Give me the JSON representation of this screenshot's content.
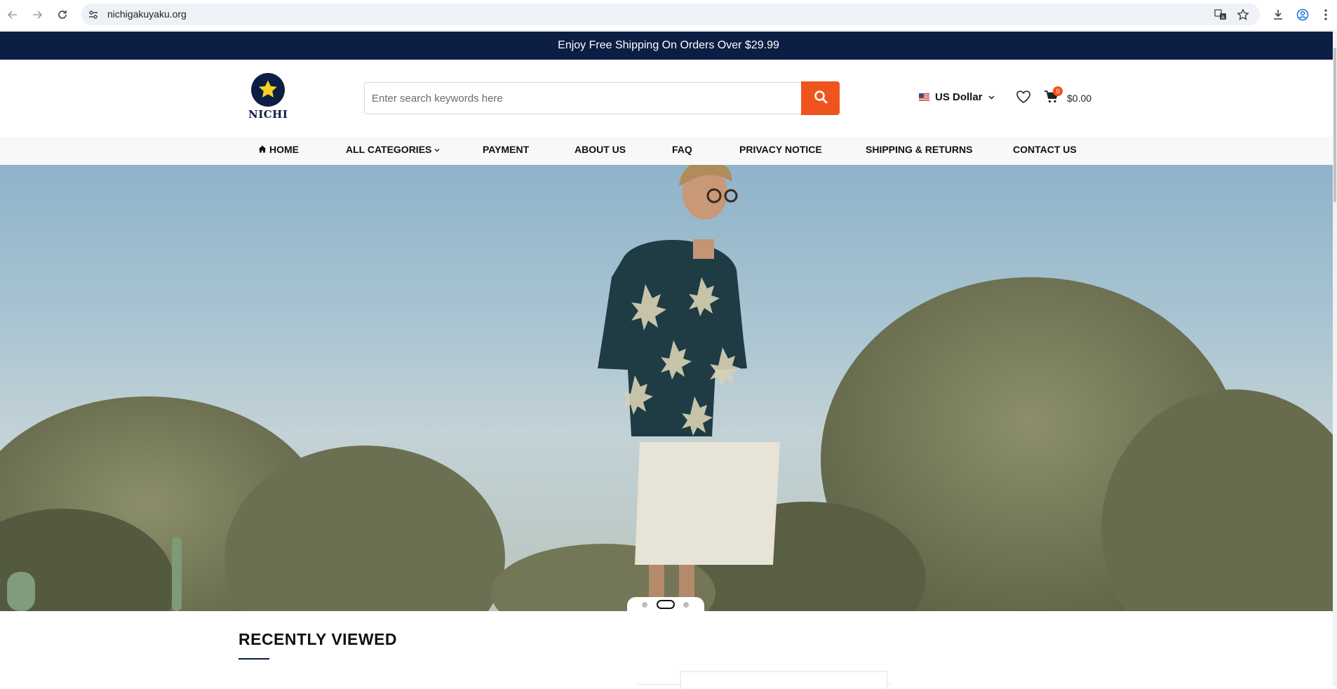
{
  "browser": {
    "url": "nichigakuyaku.org"
  },
  "promo_bar": {
    "text": "Enjoy Free Shipping On Orders Over $29.99"
  },
  "header": {
    "logo_text": "NICHI",
    "search_placeholder": "Enter search keywords here",
    "currency": "US Dollar",
    "cart_count": "0",
    "cart_total": "$0.00"
  },
  "menu": {
    "items": [
      {
        "label": "HOME",
        "icon": "home-icon"
      },
      {
        "label": "ALL CATEGORIES",
        "icon": "chevron-down-icon"
      },
      {
        "label": "PAYMENT"
      },
      {
        "label": "ABOUT US"
      },
      {
        "label": "FAQ"
      },
      {
        "label": "PRIVACY NOTICE"
      },
      {
        "label": "SHIPPING & RETURNS"
      },
      {
        "label": "CONTACT US"
      }
    ]
  },
  "hero": {
    "slides": 3,
    "active_slide": 2
  },
  "recently_viewed": {
    "title": "RECENTLY VIEWED"
  },
  "colors": {
    "navy": "#0c1e44",
    "accent": "#f0541e"
  }
}
